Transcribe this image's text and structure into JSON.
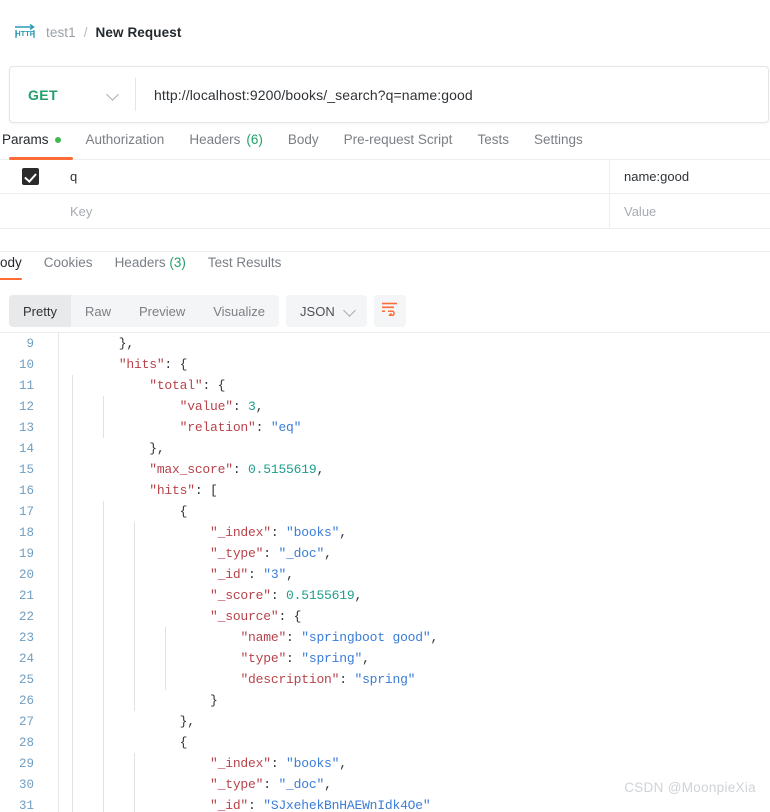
{
  "breadcrumb": {
    "icon": "http-protocol-icon",
    "collection": "test1",
    "separator": "/",
    "request_name": "New Request"
  },
  "url_bar": {
    "method": "GET",
    "method_color": "#22a06b",
    "url": "http://localhost:9200/books/_search?q=name:good"
  },
  "request_tabs": [
    {
      "label": "Params",
      "active": true,
      "has_dot": true,
      "count": ""
    },
    {
      "label": "Authorization",
      "active": false,
      "has_dot": false,
      "count": ""
    },
    {
      "label": "Headers",
      "active": false,
      "has_dot": false,
      "count": "(6)"
    },
    {
      "label": "Body",
      "active": false,
      "has_dot": false,
      "count": ""
    },
    {
      "label": "Pre-request Script",
      "active": false,
      "has_dot": false,
      "count": ""
    },
    {
      "label": "Tests",
      "active": false,
      "has_dot": false,
      "count": ""
    },
    {
      "label": "Settings",
      "active": false,
      "has_dot": false,
      "count": ""
    }
  ],
  "params": {
    "rows": [
      {
        "checked": true,
        "key": "q",
        "value": "name:good",
        "is_placeholder": false
      },
      {
        "checked": false,
        "key": "Key",
        "value": "Value",
        "is_placeholder": true
      }
    ]
  },
  "response_tabs": [
    {
      "label": "Body",
      "active": true,
      "count": ""
    },
    {
      "label": "Cookies",
      "active": false,
      "count": ""
    },
    {
      "label": "Headers",
      "active": false,
      "count": "(3)"
    },
    {
      "label": "Test Results",
      "active": false,
      "count": ""
    }
  ],
  "format_bar": {
    "views": [
      {
        "label": "Pretty",
        "active": true
      },
      {
        "label": "Raw",
        "active": false
      },
      {
        "label": "Preview",
        "active": false
      },
      {
        "label": "Visualize",
        "active": false
      }
    ],
    "language": "JSON",
    "wrap_icon": "word-wrap-icon",
    "accent_color": "#ff6c37"
  },
  "code": {
    "first_line_number": 9,
    "lines": [
      {
        "n": 9,
        "indent_guides": 0,
        "tokens": [
          {
            "t": "        },",
            "c": "p"
          }
        ]
      },
      {
        "n": 10,
        "indent_guides": 0,
        "tokens": [
          {
            "t": "        ",
            "c": "p"
          },
          {
            "t": "\"hits\"",
            "c": "k"
          },
          {
            "t": ": {",
            "c": "p"
          }
        ]
      },
      {
        "n": 11,
        "indent_guides": 1,
        "tokens": [
          {
            "t": "            ",
            "c": "p"
          },
          {
            "t": "\"total\"",
            "c": "k"
          },
          {
            "t": ": {",
            "c": "p"
          }
        ]
      },
      {
        "n": 12,
        "indent_guides": 2,
        "tokens": [
          {
            "t": "                ",
            "c": "p"
          },
          {
            "t": "\"value\"",
            "c": "k"
          },
          {
            "t": ": ",
            "c": "p"
          },
          {
            "t": "3",
            "c": "n"
          },
          {
            "t": ",",
            "c": "p"
          }
        ]
      },
      {
        "n": 13,
        "indent_guides": 2,
        "tokens": [
          {
            "t": "                ",
            "c": "p"
          },
          {
            "t": "\"relation\"",
            "c": "k"
          },
          {
            "t": ": ",
            "c": "p"
          },
          {
            "t": "\"eq\"",
            "c": "s"
          }
        ]
      },
      {
        "n": 14,
        "indent_guides": 1,
        "tokens": [
          {
            "t": "            },",
            "c": "p"
          }
        ]
      },
      {
        "n": 15,
        "indent_guides": 1,
        "tokens": [
          {
            "t": "            ",
            "c": "p"
          },
          {
            "t": "\"max_score\"",
            "c": "k"
          },
          {
            "t": ": ",
            "c": "p"
          },
          {
            "t": "0.5155619",
            "c": "n"
          },
          {
            "t": ",",
            "c": "p"
          }
        ]
      },
      {
        "n": 16,
        "indent_guides": 1,
        "tokens": [
          {
            "t": "            ",
            "c": "p"
          },
          {
            "t": "\"hits\"",
            "c": "k"
          },
          {
            "t": ": [",
            "c": "p"
          }
        ]
      },
      {
        "n": 17,
        "indent_guides": 2,
        "tokens": [
          {
            "t": "                {",
            "c": "p"
          }
        ]
      },
      {
        "n": 18,
        "indent_guides": 3,
        "tokens": [
          {
            "t": "                    ",
            "c": "p"
          },
          {
            "t": "\"_index\"",
            "c": "k"
          },
          {
            "t": ": ",
            "c": "p"
          },
          {
            "t": "\"books\"",
            "c": "s"
          },
          {
            "t": ",",
            "c": "p"
          }
        ]
      },
      {
        "n": 19,
        "indent_guides": 3,
        "tokens": [
          {
            "t": "                    ",
            "c": "p"
          },
          {
            "t": "\"_type\"",
            "c": "k"
          },
          {
            "t": ": ",
            "c": "p"
          },
          {
            "t": "\"_doc\"",
            "c": "s"
          },
          {
            "t": ",",
            "c": "p"
          }
        ]
      },
      {
        "n": 20,
        "indent_guides": 3,
        "tokens": [
          {
            "t": "                    ",
            "c": "p"
          },
          {
            "t": "\"_id\"",
            "c": "k"
          },
          {
            "t": ": ",
            "c": "p"
          },
          {
            "t": "\"3\"",
            "c": "s"
          },
          {
            "t": ",",
            "c": "p"
          }
        ]
      },
      {
        "n": 21,
        "indent_guides": 3,
        "tokens": [
          {
            "t": "                    ",
            "c": "p"
          },
          {
            "t": "\"_score\"",
            "c": "k"
          },
          {
            "t": ": ",
            "c": "p"
          },
          {
            "t": "0.5155619",
            "c": "n"
          },
          {
            "t": ",",
            "c": "p"
          }
        ]
      },
      {
        "n": 22,
        "indent_guides": 3,
        "tokens": [
          {
            "t": "                    ",
            "c": "p"
          },
          {
            "t": "\"_source\"",
            "c": "k"
          },
          {
            "t": ": {",
            "c": "p"
          }
        ]
      },
      {
        "n": 23,
        "indent_guides": 4,
        "tokens": [
          {
            "t": "                        ",
            "c": "p"
          },
          {
            "t": "\"name\"",
            "c": "k"
          },
          {
            "t": ": ",
            "c": "p"
          },
          {
            "t": "\"springboot good\"",
            "c": "s"
          },
          {
            "t": ",",
            "c": "p"
          }
        ]
      },
      {
        "n": 24,
        "indent_guides": 4,
        "tokens": [
          {
            "t": "                        ",
            "c": "p"
          },
          {
            "t": "\"type\"",
            "c": "k"
          },
          {
            "t": ": ",
            "c": "p"
          },
          {
            "t": "\"spring\"",
            "c": "s"
          },
          {
            "t": ",",
            "c": "p"
          }
        ]
      },
      {
        "n": 25,
        "indent_guides": 4,
        "tokens": [
          {
            "t": "                        ",
            "c": "p"
          },
          {
            "t": "\"description\"",
            "c": "k"
          },
          {
            "t": ": ",
            "c": "p"
          },
          {
            "t": "\"spring\"",
            "c": "s"
          }
        ]
      },
      {
        "n": 26,
        "indent_guides": 3,
        "tokens": [
          {
            "t": "                    }",
            "c": "p"
          }
        ]
      },
      {
        "n": 27,
        "indent_guides": 2,
        "tokens": [
          {
            "t": "                },",
            "c": "p"
          }
        ]
      },
      {
        "n": 28,
        "indent_guides": 2,
        "tokens": [
          {
            "t": "                {",
            "c": "p"
          }
        ]
      },
      {
        "n": 29,
        "indent_guides": 3,
        "tokens": [
          {
            "t": "                    ",
            "c": "p"
          },
          {
            "t": "\"_index\"",
            "c": "k"
          },
          {
            "t": ": ",
            "c": "p"
          },
          {
            "t": "\"books\"",
            "c": "s"
          },
          {
            "t": ",",
            "c": "p"
          }
        ]
      },
      {
        "n": 30,
        "indent_guides": 3,
        "tokens": [
          {
            "t": "                    ",
            "c": "p"
          },
          {
            "t": "\"_type\"",
            "c": "k"
          },
          {
            "t": ": ",
            "c": "p"
          },
          {
            "t": "\"_doc\"",
            "c": "s"
          },
          {
            "t": ",",
            "c": "p"
          }
        ]
      },
      {
        "n": 31,
        "indent_guides": 3,
        "tokens": [
          {
            "t": "                    ",
            "c": "p"
          },
          {
            "t": "\"_id\"",
            "c": "k"
          },
          {
            "t": ": ",
            "c": "p"
          },
          {
            "t": "\"SJxehekBnHAEWnIdk4Oe\"",
            "c": "s"
          }
        ]
      }
    ]
  },
  "watermark": "CSDN @MoonpieXia"
}
